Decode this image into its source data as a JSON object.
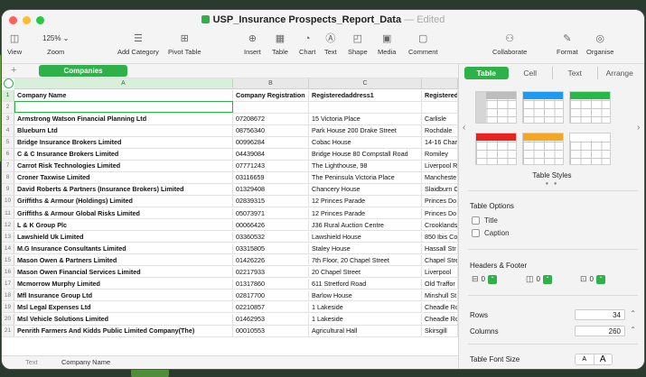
{
  "window": {
    "title": "USP_Insurance Prospects_Report_Data",
    "edited": "— Edited"
  },
  "toolbar": {
    "view": "View",
    "zoom_value": "125% ⌄",
    "zoom": "Zoom",
    "add_category": "Add Category",
    "pivot_table": "Pivot Table",
    "insert": "Insert",
    "table": "Table",
    "chart": "Chart",
    "text": "Text",
    "shape": "Shape",
    "media": "Media",
    "comment": "Comment",
    "collaborate": "Collaborate",
    "format": "Format",
    "organise": "Organise"
  },
  "sheet": {
    "add": "+",
    "active_tab": "Companies"
  },
  "grid": {
    "columns": [
      "A",
      "B",
      "C"
    ],
    "rows": [
      {
        "n": "1",
        "a": "Company Name",
        "b": "Company Registration",
        "c": "Registeredaddress1",
        "d": "Registered"
      },
      {
        "n": "2",
        "a": "",
        "b": "",
        "c": "",
        "d": ""
      },
      {
        "n": "3",
        "a": "Armstrong Watson Financial Planning Ltd",
        "b": "07208672",
        "c": "15 Victoria Place",
        "d": "Carlisle"
      },
      {
        "n": "4",
        "a": "Blueburn Ltd",
        "b": "08756340",
        "c": "Park House 200 Drake Street",
        "d": "Rochdale"
      },
      {
        "n": "5",
        "a": "Bridge Insurance Brokers Limited",
        "b": "00996284",
        "c": "Cobac House",
        "d": "14-16 Char"
      },
      {
        "n": "6",
        "a": "C & C Insurance Brokers Limited",
        "b": "04439084",
        "c": "Bridge House 80 Compstall Road",
        "d": "Romiley"
      },
      {
        "n": "7",
        "a": "Carrot Risk Technologies Limited",
        "b": "07771243",
        "c": "The Lighthouse, 98",
        "d": "Liverpool R"
      },
      {
        "n": "8",
        "a": "Croner Taxwise Limited",
        "b": "03116659",
        "c": "The Peninsula Victoria Place",
        "d": "Mancheste"
      },
      {
        "n": "9",
        "a": "David Roberts & Partners (Insurance Brokers) Limited",
        "b": "01329408",
        "c": "Chancery House",
        "d": "Slaidburn C"
      },
      {
        "n": "10",
        "a": "Griffiths & Armour (Holdings) Limited",
        "b": "02839315",
        "c": "12 Princes Parade",
        "d": "Princes Do"
      },
      {
        "n": "11",
        "a": "Griffiths & Armour Global Risks Limited",
        "b": "05073971",
        "c": "12 Princes Parade",
        "d": "Princes Do"
      },
      {
        "n": "12",
        "a": "L & K Group Plc",
        "b": "00066426",
        "c": "J36 Rural Auction Centre",
        "d": "Crooklands"
      },
      {
        "n": "13",
        "a": "Lawshield Uk Limited",
        "b": "03360532",
        "c": "Lawshield House",
        "d": "850 Ibis Co"
      },
      {
        "n": "14",
        "a": "M.G Insurance Consultants Limited",
        "b": "03315805",
        "c": "Staley House",
        "d": "Hassall Str"
      },
      {
        "n": "15",
        "a": "Mason Owen & Partners Limited",
        "b": "01426226",
        "c": "7th Floor, 20 Chapel Street",
        "d": "Chapel Stre"
      },
      {
        "n": "16",
        "a": "Mason Owen Financial Services Limited",
        "b": "02217933",
        "c": "20 Chapel Street",
        "d": "Liverpool"
      },
      {
        "n": "17",
        "a": "Mcmorrow Murphy Limited",
        "b": "01317860",
        "c": "611 Stretford Road",
        "d": "Old Traffor"
      },
      {
        "n": "18",
        "a": "Mfl Insurance Group Ltd",
        "b": "02817700",
        "c": "Barlow House",
        "d": "Minshull St"
      },
      {
        "n": "19",
        "a": "Msl Legal Expenses Ltd",
        "b": "02210857",
        "c": "1 Lakeside",
        "d": "Cheadle Ro"
      },
      {
        "n": "20",
        "a": "Msl Vehicle Solutions Limited",
        "b": "01462953",
        "c": "1 Lakeside",
        "d": "Cheadle Ro"
      },
      {
        "n": "21",
        "a": "Penrith Farmers And Kidds Public Limited Company(The)",
        "b": "00010553",
        "c": "Agricultural Hall",
        "d": "Skirsgill"
      }
    ]
  },
  "bottom": {
    "type_label": "Text",
    "cell_value": "Company Name"
  },
  "sidebar": {
    "tabs": [
      "Table",
      "Cell",
      "Text",
      "Arrange"
    ],
    "table_styles": "Table Styles",
    "style_colors": [
      "#ffffff",
      "#1e9bf0",
      "#28b84a",
      "#e8221e",
      "#f5a623",
      "#ffffff"
    ],
    "table_options": "Table Options",
    "opt_title": "Title",
    "opt_caption": "Caption",
    "headers_footer": "Headers & Footer",
    "header_rows": "0",
    "header_cols": "0",
    "footer_rows": "0",
    "rows_label": "Rows",
    "rows_value": "34",
    "columns_label": "Columns",
    "columns_value": "260",
    "font_size_label": "Table Font Size",
    "font_small": "A",
    "font_large": "A"
  }
}
